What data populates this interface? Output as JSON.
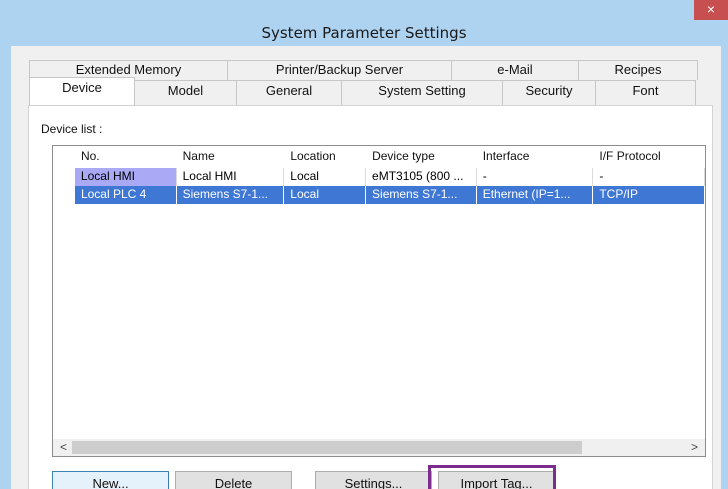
{
  "window": {
    "title": "System Parameter Settings",
    "close_label": "×"
  },
  "tabs": {
    "back_row": [
      "Extended Memory",
      "Printer/Backup Server",
      "e-Mail",
      "Recipes"
    ],
    "front_row": [
      "Device",
      "Model",
      "General",
      "System Setting",
      "Security",
      "Font"
    ],
    "active": "Device"
  },
  "device_list": {
    "label": "Device list :",
    "columns": [
      "No.",
      "Name",
      "Location",
      "Device type",
      "Interface",
      "I/F Protocol"
    ],
    "rows": [
      {
        "marker": "",
        "no": "Local HMI",
        "name": "Local HMI",
        "location": "Local",
        "device_type": "eMT3105 (800 ...",
        "interface": "-",
        "protocol": "-"
      },
      {
        "marker": "▶",
        "no": "Local PLC 4",
        "name": "Siemens S7-1...",
        "location": "Local",
        "device_type": "Siemens S7-1...",
        "interface": "Ethernet (IP=1...",
        "protocol": "TCP/IP"
      }
    ],
    "selected_row_index": 1,
    "scroll_left_icon": "<",
    "scroll_right_icon": ">"
  },
  "buttons": {
    "new": "New...",
    "delete": "Delete",
    "settings": "Settings...",
    "import_tag": "Import Tag..."
  },
  "colors": {
    "title_bar": "#aed3f0",
    "selection": "#3f77d4",
    "highlight_cell": "#a9a9f5",
    "annotation_frame": "#7b2d8e",
    "close_button": "#c74f4f"
  }
}
